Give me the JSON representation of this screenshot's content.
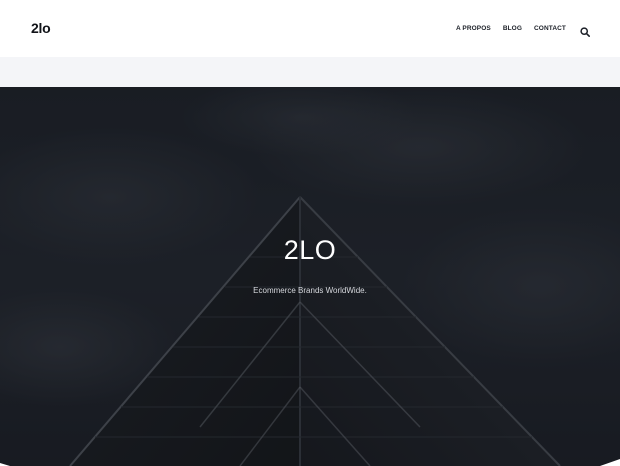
{
  "header": {
    "logo": "2lo",
    "nav": [
      {
        "label": "A PROPOS"
      },
      {
        "label": "BLOG"
      },
      {
        "label": "CONTACT"
      }
    ],
    "search_icon": "search-icon"
  },
  "hero": {
    "title": "2LO",
    "subtitle": "Ecommerce Brands WorldWide."
  },
  "colors": {
    "header_bg": "#ffffff",
    "band_bg": "#f4f5f8",
    "hero_overlay": "#1d2027",
    "text_dark": "#111318",
    "text_light": "#ffffff"
  }
}
